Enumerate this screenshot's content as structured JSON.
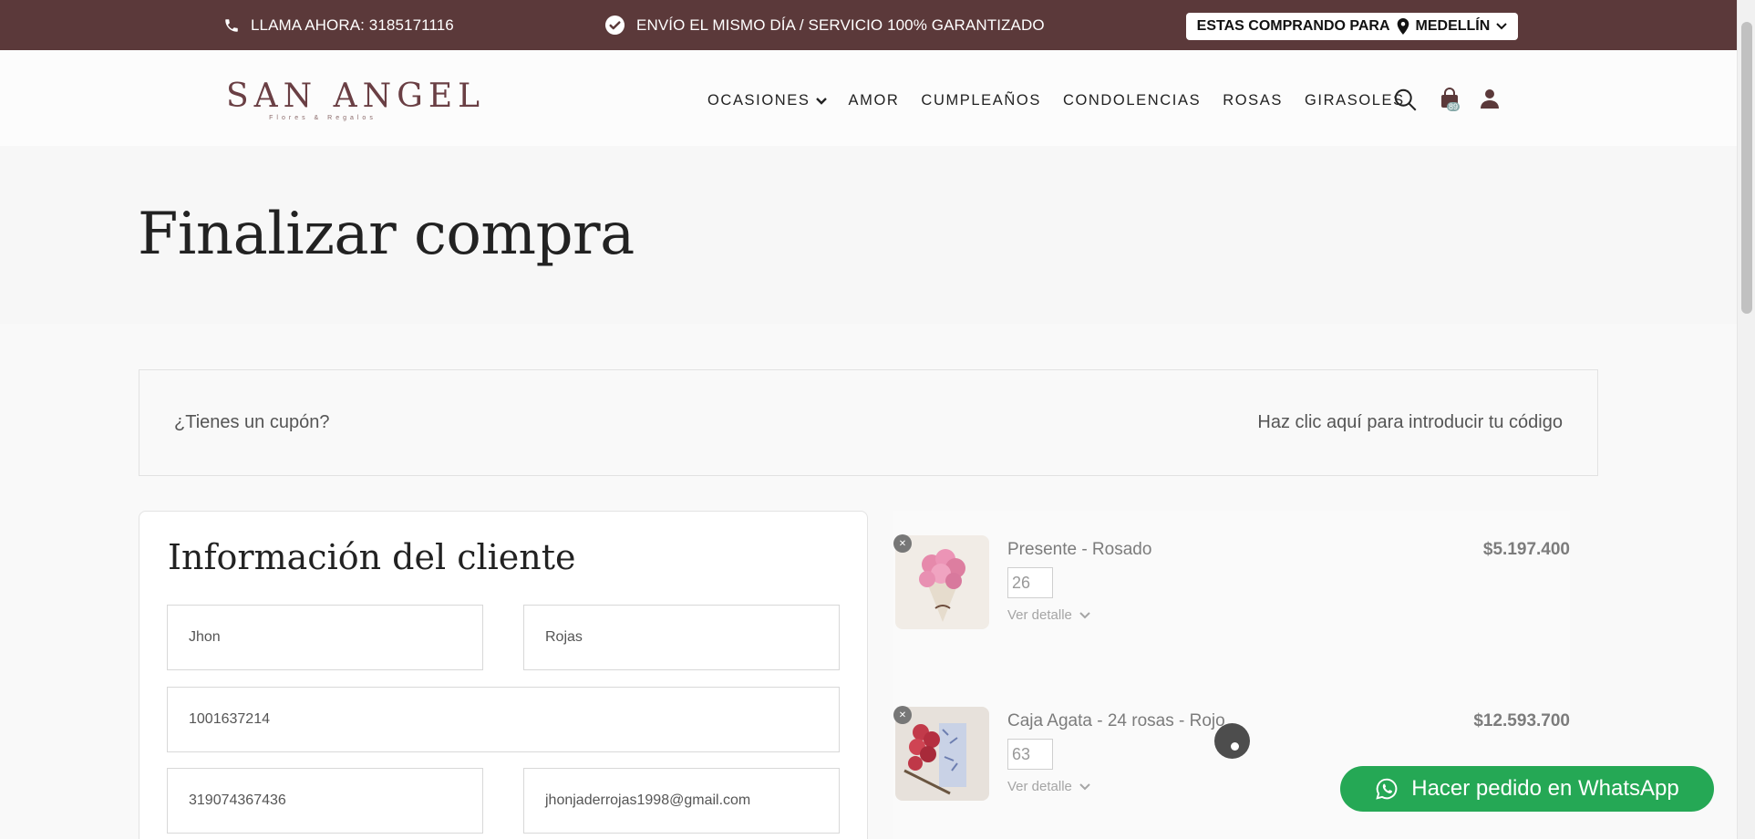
{
  "topbar": {
    "phone_label": "LLAMA AHORA: 3185171116",
    "shipping_label": "ENVÍO EL MISMO DÍA / SERVICIO 100% GARANTIZADO",
    "location_prefix": "ESTAS COMPRANDO PARA",
    "location_city": "MEDELLÍN",
    "bg_color": "#5b393a"
  },
  "header": {
    "logo_text": "SAN ANGEL",
    "logo_subtext": "Flores & Regalos",
    "nav": [
      "OCASIONES",
      "AMOR",
      "CUMPLEAÑOS",
      "CONDOLENCIAS",
      "ROSAS",
      "GIRASOLES"
    ],
    "cart_count": "89"
  },
  "hero": {
    "title": "Finalizar compra"
  },
  "coupon": {
    "question": "¿Tienes un cupón?",
    "link": "Haz clic aquí para introducir tu código"
  },
  "customer": {
    "title": "Información del cliente",
    "first_name": "Jhon",
    "last_name": "Rojas",
    "document": "1001637214",
    "phone": "319074367436",
    "email": "jhonjaderrojas1998@gmail.com"
  },
  "order": {
    "items": [
      {
        "name": "Presente - Rosado",
        "price": "$5.197.400",
        "qty": "26",
        "detail": "Ver detalle"
      },
      {
        "name": "Caja Agata - 24 rosas - Rojo",
        "price": "$12.593.700",
        "qty": "63",
        "detail": "Ver detalle"
      }
    ]
  },
  "whatsapp": {
    "label": "Hacer pedido en WhatsApp",
    "color": "#25a855"
  }
}
